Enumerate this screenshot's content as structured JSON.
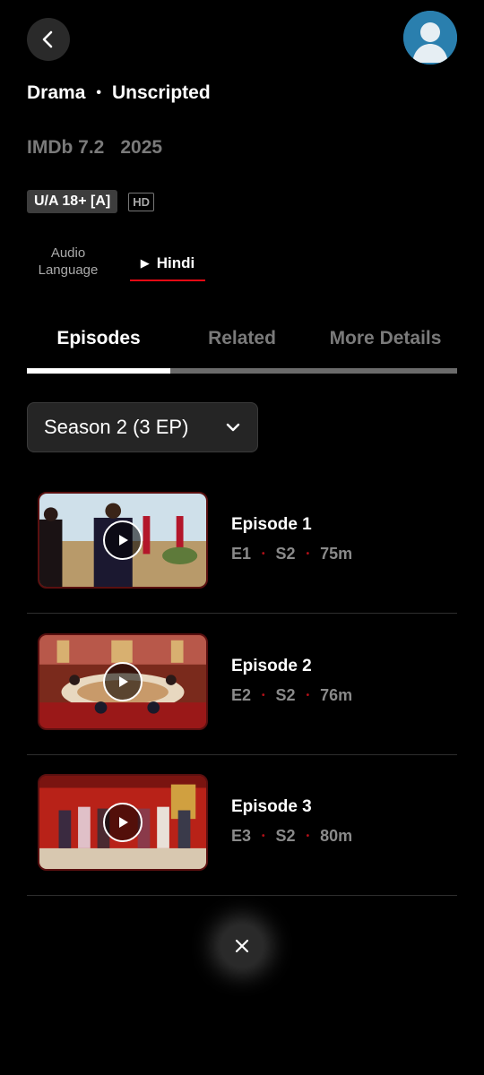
{
  "header": {
    "genres": [
      "Drama",
      "Unscripted"
    ],
    "genre_separator": "•",
    "imdb": "IMDb 7.2",
    "year": "2025",
    "rating_badge": "U/A 18+ [A]",
    "quality_badge": "HD"
  },
  "audio": {
    "label_line1": "Audio",
    "label_line2": "Language",
    "selected": "Hindi",
    "accent": "#e50914"
  },
  "tabs": [
    {
      "label": "Episodes",
      "active": true
    },
    {
      "label": "Related",
      "active": false
    },
    {
      "label": "More Details",
      "active": false
    }
  ],
  "season_select": {
    "value": "Season 2 (3 EP)"
  },
  "episodes": [
    {
      "title": "Episode 1",
      "ep": "E1",
      "season": "S2",
      "duration": "75m",
      "sep": "•"
    },
    {
      "title": "Episode 2",
      "ep": "E2",
      "season": "S2",
      "duration": "76m",
      "sep": "•"
    },
    {
      "title": "Episode 3",
      "ep": "E3",
      "season": "S2",
      "duration": "80m",
      "sep": "•"
    }
  ],
  "icons": {
    "back": "chevron-left-icon",
    "avatar": "user-avatar-icon",
    "dropdown": "chevron-down-icon",
    "play": "play-icon",
    "close": "close-icon"
  }
}
